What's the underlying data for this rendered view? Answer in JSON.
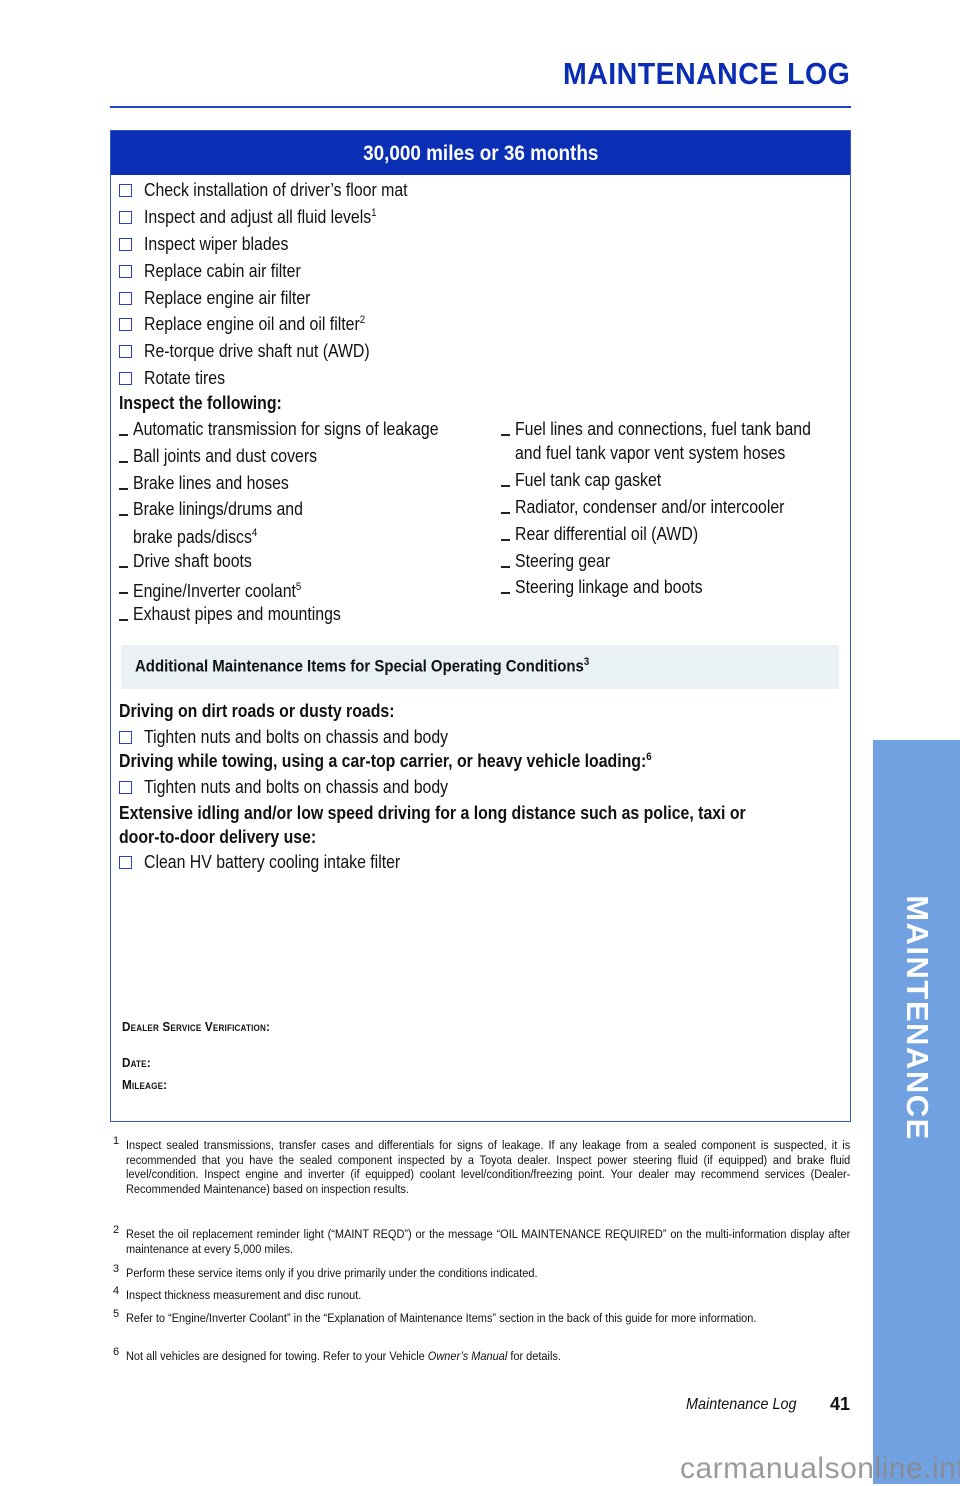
{
  "page": {
    "title": "MAINTENANCE LOG",
    "side_tab": "MAINTENANCE",
    "footer_section": "Maintenance Log",
    "page_number": "41",
    "watermark": "carmanualsonline.info"
  },
  "log": {
    "interval": "30,000 miles or 36 months",
    "checklist": [
      {
        "text": "Check installation of driver’s floor mat",
        "note": ""
      },
      {
        "text": "Inspect and adjust all fluid levels",
        "note": "1"
      },
      {
        "text": "Inspect wiper blades",
        "note": ""
      },
      {
        "text": "Replace cabin air filter",
        "note": ""
      },
      {
        "text": "Replace engine air filter",
        "note": ""
      },
      {
        "text": "Replace engine oil and oil filter",
        "note": "2"
      },
      {
        "text": "Re-torque drive shaft nut (AWD)",
        "note": ""
      },
      {
        "text": "Rotate tires",
        "note": ""
      }
    ],
    "inspect_heading": "Inspect the following:",
    "inspect_left": [
      {
        "line1": "Automatic transmission for signs of leakage",
        "line2": "",
        "note": ""
      },
      {
        "line1": "Ball joints and dust covers",
        "line2": "",
        "note": ""
      },
      {
        "line1": "Brake lines and hoses",
        "line2": "",
        "note": ""
      },
      {
        "line1": "Brake linings/drums and",
        "line2": "brake pads/discs",
        "note": "4"
      },
      {
        "line1": "Drive shaft boots",
        "line2": "",
        "note": ""
      },
      {
        "line1": "Engine/Inverter coolant",
        "line2": "",
        "note": "5"
      },
      {
        "line1": "Exhaust pipes and mountings",
        "line2": "",
        "note": ""
      }
    ],
    "inspect_right": [
      {
        "line1": "Fuel lines and connections, fuel tank band",
        "line2": "and fuel tank vapor vent system hoses",
        "note": ""
      },
      {
        "line1": "Fuel tank cap gasket",
        "line2": "",
        "note": ""
      },
      {
        "line1": "Radiator, condenser and/or intercooler",
        "line2": "",
        "note": ""
      },
      {
        "line1": "Rear differential oil (AWD)",
        "line2": "",
        "note": ""
      },
      {
        "line1": "Steering gear",
        "line2": "",
        "note": ""
      },
      {
        "line1": "Steering linkage and boots",
        "line2": "",
        "note": ""
      }
    ],
    "special": {
      "heading": "Additional Maintenance Items for Special Operating Conditions",
      "heading_note": "3",
      "conditions": [
        {
          "title": "Driving on dirt roads or dusty roads:",
          "title2": "",
          "note": "",
          "item": "Tighten nuts and bolts on chassis and body"
        },
        {
          "title": "Driving while towing, using a car-top carrier, or heavy vehicle loading:",
          "title2": "",
          "note": "6",
          "item": "Tighten nuts and bolts on chassis and body"
        },
        {
          "title": "Extensive idling and/or low speed driving for a long distance such as police, taxi or",
          "title2": "door-to-door delivery use:",
          "note": "",
          "item": "Clean HV battery cooling intake filter"
        }
      ]
    },
    "verification": {
      "dealer_label": "Dealer Service Verification:",
      "date_label": "Date:",
      "mileage_label": "Mileage:"
    }
  },
  "footnotes": [
    {
      "num": "1",
      "text": "Inspect sealed transmissions, transfer cases and differentials for signs of leakage. If any leakage from a sealed component is suspected, it is recommended that you have the sealed component inspected by a Toyota dealer. Inspect power steering fluid (if equipped) and brake fluid level/condition. Inspect engine and inverter (if equipped) coolant level/condition/freezing point. Your dealer may recommend services (Dealer-Recommended Maintenance) based on inspection results."
    },
    {
      "num": "2",
      "text": "Reset the oil replacement reminder light (“MAINT REQD”) or the message “OIL MAINTENANCE REQUIRED” on the multi-information display after maintenance at every 5,000 miles."
    },
    {
      "num": "3",
      "text": "Perform these service items only if you drive primarily under the conditions indicated."
    },
    {
      "num": "4",
      "text": "Inspect thickness measurement and disc runout."
    },
    {
      "num": "5",
      "text": "Refer to “Engine/Inverter Coolant” in the “Explanation of Maintenance Items” section in the back of this guide for more information."
    },
    {
      "num": "6",
      "text_before": "Not all vehicles are designed for towing. Refer to your Vehicle ",
      "text_italic": "Owner’s Manual",
      "text_after": " for details."
    }
  ]
}
